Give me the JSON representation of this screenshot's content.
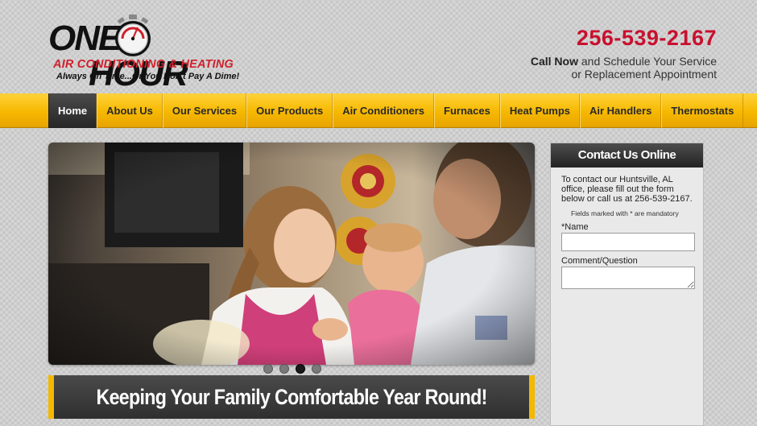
{
  "logo": {
    "word1": "ONE",
    "word2": "HOUR",
    "line2": "AIR CONDITIONING & HEATING",
    "tagline": "Always On Time...Or You Don't Pay A Dime!"
  },
  "header": {
    "phone": "256-539-2167",
    "cta_bold": "Call Now",
    "cta_rest": " and Schedule Your Service",
    "cta_line2": "or Replacement Appointment"
  },
  "nav": {
    "items": [
      {
        "label": "Home"
      },
      {
        "label": "About Us"
      },
      {
        "label": "Our Services"
      },
      {
        "label": "Our Products"
      },
      {
        "label": "Air Conditioners"
      },
      {
        "label": "Furnaces"
      },
      {
        "label": "Heat Pumps"
      },
      {
        "label": "Air Handlers"
      },
      {
        "label": "Thermostats"
      }
    ],
    "active_index": 0
  },
  "slideshow": {
    "slide_count": 4,
    "active_slide": 3,
    "banner_text": "Keeping Your Family Comfortable Year Round!"
  },
  "contact": {
    "title": "Contact Us Online",
    "intro": "To contact our Huntsville, AL office, please fill out the form below or call us at 256-539-2167.",
    "mandatory_note": "Fields marked with * are mandatory",
    "name_label": "*Name",
    "name_value": "",
    "comment_label": "Comment/Question",
    "comment_value": ""
  },
  "colors": {
    "accent_yellow": "#f6b800",
    "brand_red": "#c8102e",
    "dark": "#2f2f2f"
  }
}
